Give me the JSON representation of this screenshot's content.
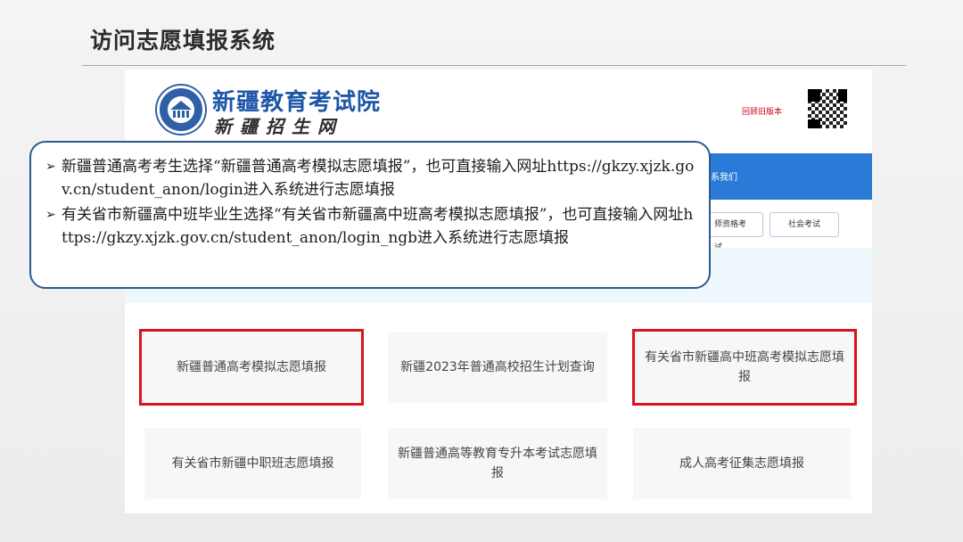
{
  "slide": {
    "title": "访问志愿填报系统"
  },
  "site": {
    "name": "新疆教育考试院",
    "subname": "新疆招生网",
    "old_version_link": "回顾旧版本",
    "nav_contact": "系我们",
    "tabs": [
      "师资格考试",
      "社会考试"
    ]
  },
  "callout": {
    "bullets": [
      "新疆普通高考考生选择“新疆普通高考模拟志愿填报”，也可直接输入网址https://gkzy.xjzk.gov.cn/student_anon/login进入系统进行志愿填报",
      "有关省市新疆高中班毕业生选择“有关省市新疆高中班高考模拟志愿填报”，也可直接输入网址https://gkzy.xjzk.gov.cn/student_anon/login_ngb进入系统进行志愿填报"
    ],
    "bullet_marker": "➢"
  },
  "cards": [
    {
      "label": "新疆普通高考模拟志愿填报",
      "highlighted": true
    },
    {
      "label": "新疆2023年普通高校招生计划查询",
      "highlighted": false
    },
    {
      "label": "有关省市新疆高中班高考模拟志愿填报",
      "highlighted": true
    },
    {
      "label": "有关省市新疆中职班志愿填报",
      "highlighted": false
    },
    {
      "label": "新疆普通高等教育专升本考试志愿填报",
      "highlighted": false
    },
    {
      "label": "成人高考征集志愿填报",
      "highlighted": false
    }
  ],
  "colors": {
    "nav": "#2a7ad8",
    "highlight": "#d9141b",
    "callout_border": "#2d5a8c",
    "brand": "#1e56a8"
  }
}
